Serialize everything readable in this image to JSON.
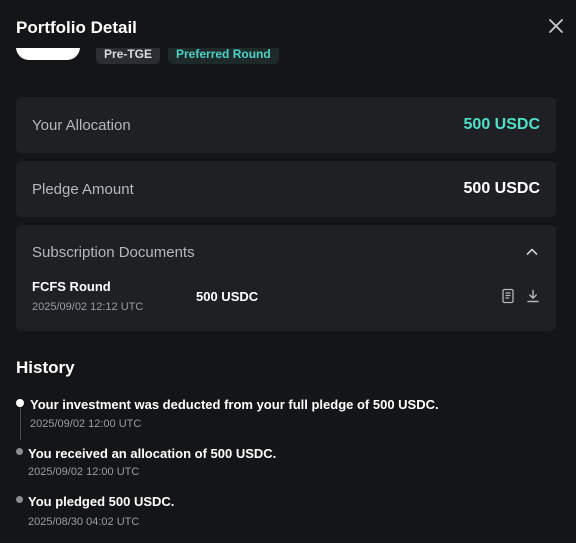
{
  "dialog": {
    "title": "Portfolio Detail",
    "close_icon": "close-icon"
  },
  "chips": {
    "pre_tge": "Pre-TGE",
    "preferred_round": "Preferred Round"
  },
  "allocation": {
    "label": "Your Allocation",
    "value": "500 USDC",
    "value_color": "#4fe0c8"
  },
  "pledge": {
    "label": "Pledge Amount",
    "value": "500 USDC"
  },
  "subscription_documents": {
    "label": "Subscription Documents",
    "toggle_icon": "chevron-up-icon",
    "items": [
      {
        "name": "FCFS Round",
        "date": "2025/09/02 12:12 UTC",
        "amount": "500 USDC",
        "view_icon": "document-icon",
        "download_icon": "download-icon"
      }
    ]
  },
  "history": {
    "title": "History",
    "events": [
      {
        "text": "Your investment was deducted from your full pledge of 500 USDC.",
        "date": "2025/09/02 12:00 UTC",
        "active": true
      },
      {
        "text": "You received an allocation of 500 USDC.",
        "date": "2025/09/02 12:00 UTC",
        "active": false
      },
      {
        "text": "You pledged 500 USDC.",
        "date": "2025/08/30 04:02 UTC",
        "active": false
      }
    ]
  }
}
